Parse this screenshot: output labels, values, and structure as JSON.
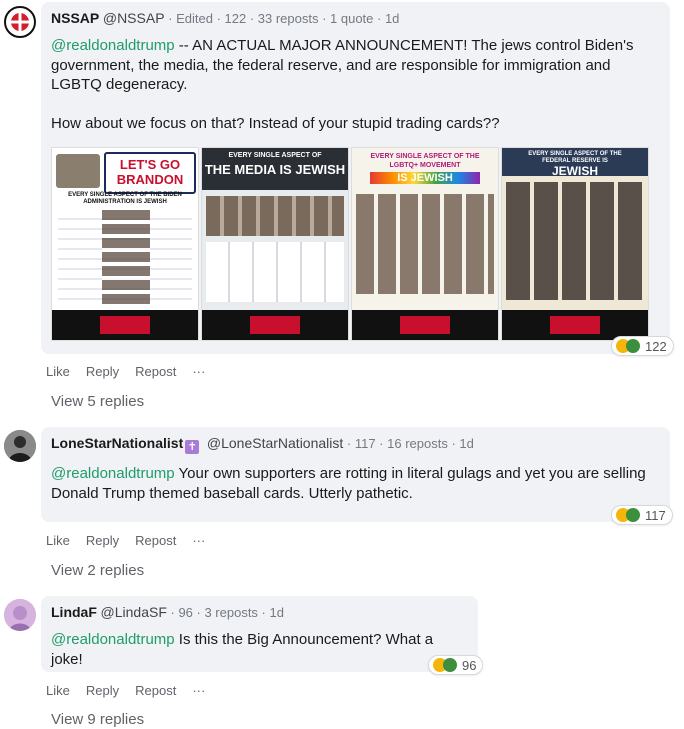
{
  "comments": [
    {
      "name": "NSSAP",
      "handle": "@NSSAP",
      "meta_rest": "· Edited · 122 · 33 reposts · 1 quote · 1d",
      "mention": "@realdonaldtrump",
      "text_1": " -- AN ACTUAL MAJOR ANNOUNCEMENT! The jews control Biden's government, the media, the federal reserve, and are responsible for immigration and LGBTQ degeneracy.",
      "text_2": "How about we focus on that? Instead of your stupid trading cards??",
      "reaction_count": "122",
      "actions": [
        "Like",
        "Reply",
        "Repost",
        "···"
      ],
      "view_replies": "View 5 replies",
      "images": [
        {
          "title": "LET'S GO BRANDON",
          "caption": "EVERY SINGLE ASPECT OF THE BIDEN ADMINISTRATION IS JEWISH"
        },
        {
          "title": "THE MEDIA IS JEWISH",
          "caption": "EVERY SINGLE ASPECT OF"
        },
        {
          "title": "IS JEWISH",
          "caption": "EVERY SINGLE ASPECT OF THE LGBTQ+ MOVEMENT"
        },
        {
          "title": "JEWISH",
          "caption": "EVERY SINGLE ASPECT OF THE FEDERAL RESERVE IS"
        }
      ]
    },
    {
      "name": "LoneStarNationalist",
      "handle": "@LoneStarNationalist",
      "meta_rest": "· 117 · 16 reposts · 1d",
      "mention": "@realdonaldtrump",
      "text_1": " Your own supporters are rotting in literal gulags and yet you are selling Donald Trump themed baseball cards. Utterly pathetic.",
      "reaction_count": "117",
      "actions": [
        "Like",
        "Reply",
        "Repost",
        "···"
      ],
      "view_replies": "View 2 replies"
    },
    {
      "name": "LindaF",
      "handle": "@LindaSF",
      "meta_rest": "· 96 · 3 reposts · 1d",
      "mention": "@realdonaldtrump",
      "text_1": " Is this the Big Announcement? What a joke!",
      "reaction_count": "96",
      "actions": [
        "Like",
        "Reply",
        "Repost",
        "···"
      ],
      "view_replies": "View 9 replies"
    }
  ],
  "colors": {
    "mention": "#1f9d6a",
    "bubble": "#f0f2f5",
    "muted": "#747a82"
  }
}
